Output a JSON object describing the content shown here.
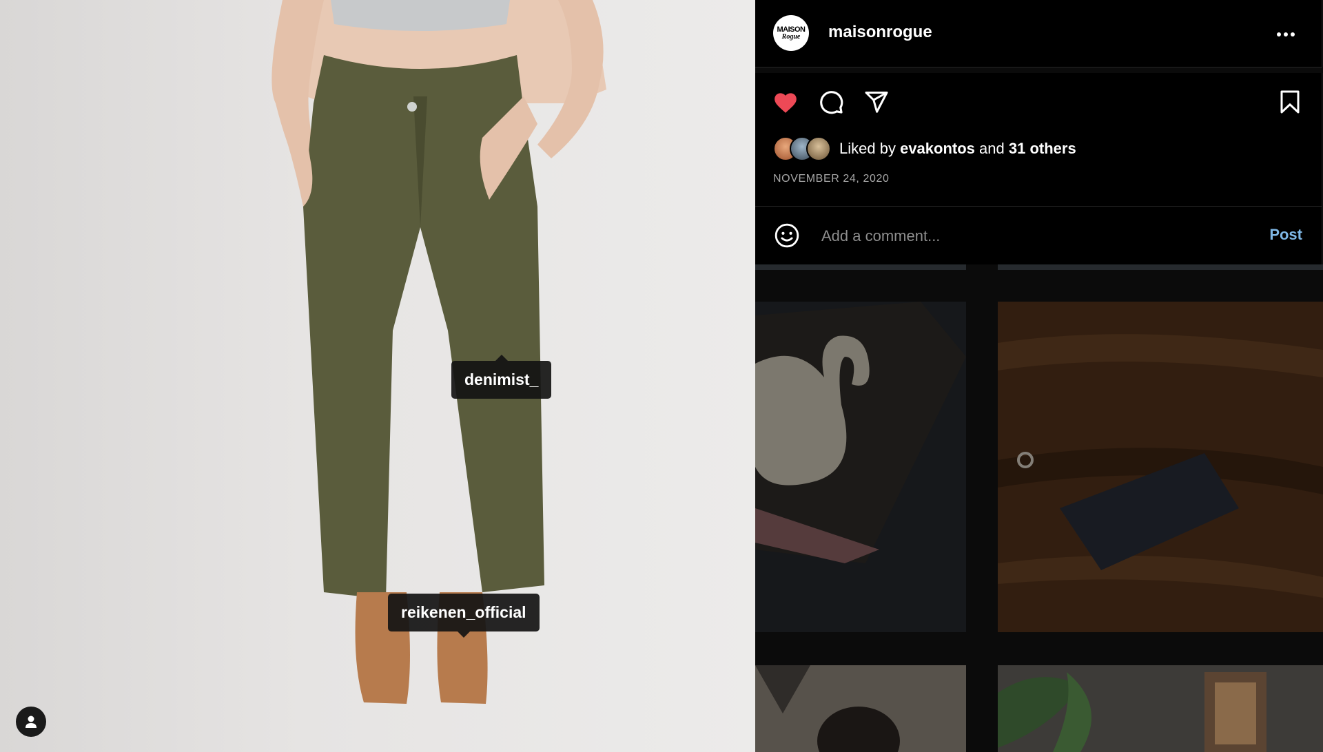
{
  "post": {
    "photo_tags": [
      {
        "label": "denimist_"
      },
      {
        "label": "reikenen_official"
      }
    ],
    "user_tags_icon": "person-icon"
  },
  "header": {
    "avatar_text_top": "MAISON",
    "avatar_text_bottom": "Rogue",
    "username": "maisonrogue",
    "more_icon": "more-horizontal-icon"
  },
  "actions": {
    "like_icon": "heart-filled-icon",
    "comment_icon": "comment-icon",
    "share_icon": "paper-plane-icon",
    "save_icon": "bookmark-icon",
    "liked_by_prefix": "Liked by",
    "liked_by_user": "evakontos",
    "liked_by_and": "and",
    "liked_by_others": "31 others",
    "date": "NOVEMBER 24, 2020"
  },
  "comment": {
    "emoji_icon": "smiley-icon",
    "placeholder": "Add a comment...",
    "post_label": "Post"
  },
  "colors": {
    "like": "#ed4956",
    "post_link": "#7fb8e6",
    "panel_bg": "#000000"
  }
}
